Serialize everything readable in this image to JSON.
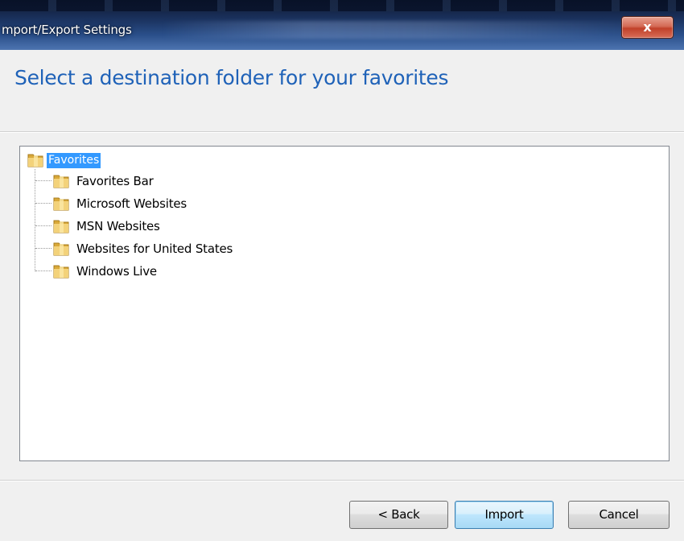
{
  "window": {
    "title": "mport/Export Settings",
    "close_label": "x"
  },
  "page": {
    "heading": "Select a destination folder for your favorites"
  },
  "tree": {
    "root": {
      "label": "Favorites",
      "selected": true,
      "icon": "folder-icon"
    },
    "items": [
      {
        "label": "Favorites Bar",
        "icon": "folder-icon"
      },
      {
        "label": "Microsoft Websites",
        "icon": "folder-icon"
      },
      {
        "label": "MSN Websites",
        "icon": "folder-icon"
      },
      {
        "label": "Websites for United States",
        "icon": "folder-icon"
      },
      {
        "label": "Windows Live",
        "icon": "folder-icon"
      }
    ]
  },
  "buttons": {
    "back": "< Back",
    "import": "Import",
    "cancel": "Cancel"
  },
  "colors": {
    "heading": "#1f62b8",
    "selection": "#3399ff",
    "folder": "#e8c25a"
  }
}
